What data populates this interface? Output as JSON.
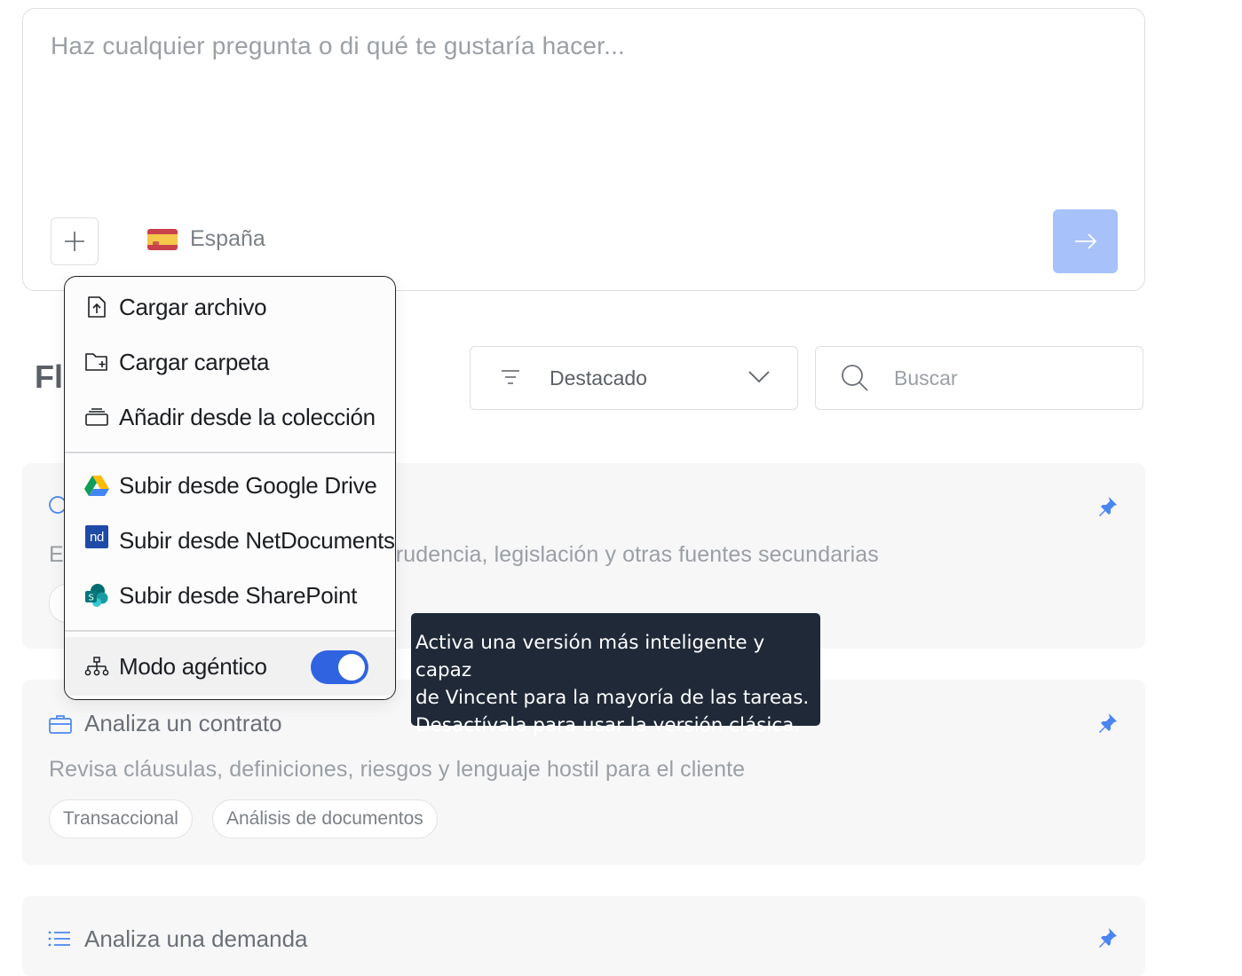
{
  "prompt": {
    "placeholder": "Haz cualquier pregunta o di qué te gustaría hacer...",
    "country_label": "España",
    "add_icon": "plus-icon",
    "send_icon": "arrow-right-icon",
    "send_color": "#a7c1fb"
  },
  "section": {
    "title_partial": "Fl"
  },
  "toolbar": {
    "sort_label": "Destacado",
    "search_placeholder": "Buscar"
  },
  "cards": [
    {
      "title": "",
      "description_visible": "E",
      "description_tail": "prudencia, legislación y otras fuentes secundarias",
      "icon": "circle-icon"
    },
    {
      "title": "Analiza un contrato",
      "description": "Revisa cláusulas, definiciones, riesgos y lenguaje hostil para el cliente",
      "tags": [
        "Transaccional",
        "Análisis de documentos"
      ],
      "icon": "briefcase-icon"
    },
    {
      "title": "Analiza una demanda",
      "icon": "list-icon"
    }
  ],
  "menu": {
    "items": [
      {
        "label": "Cargar archivo",
        "icon": "file-upload-icon"
      },
      {
        "label": "Cargar carpeta",
        "icon": "folder-add-icon"
      },
      {
        "label": "Añadir desde la colección",
        "icon": "collection-icon"
      },
      {
        "label": "Subir desde Google Drive",
        "icon": "google-drive-icon"
      },
      {
        "label": "Subir desde NetDocuments",
        "icon": "netdocuments-icon"
      },
      {
        "label": "Subir desde SharePoint",
        "icon": "sharepoint-icon"
      }
    ],
    "agent_mode": {
      "label": "Modo agéntico",
      "icon": "network-icon",
      "enabled": true
    },
    "netdocuments_badge": "nd"
  },
  "tooltip": {
    "line1": "Activa una versión más inteligente y capaz",
    "line2": "de Vincent para la mayoría de las tareas.",
    "line3": "Desactívala para usar la versión clásica."
  },
  "colors": {
    "accent": "#2f63e0",
    "pin": "#4a86f0",
    "tooltip_bg": "#1f2937"
  }
}
